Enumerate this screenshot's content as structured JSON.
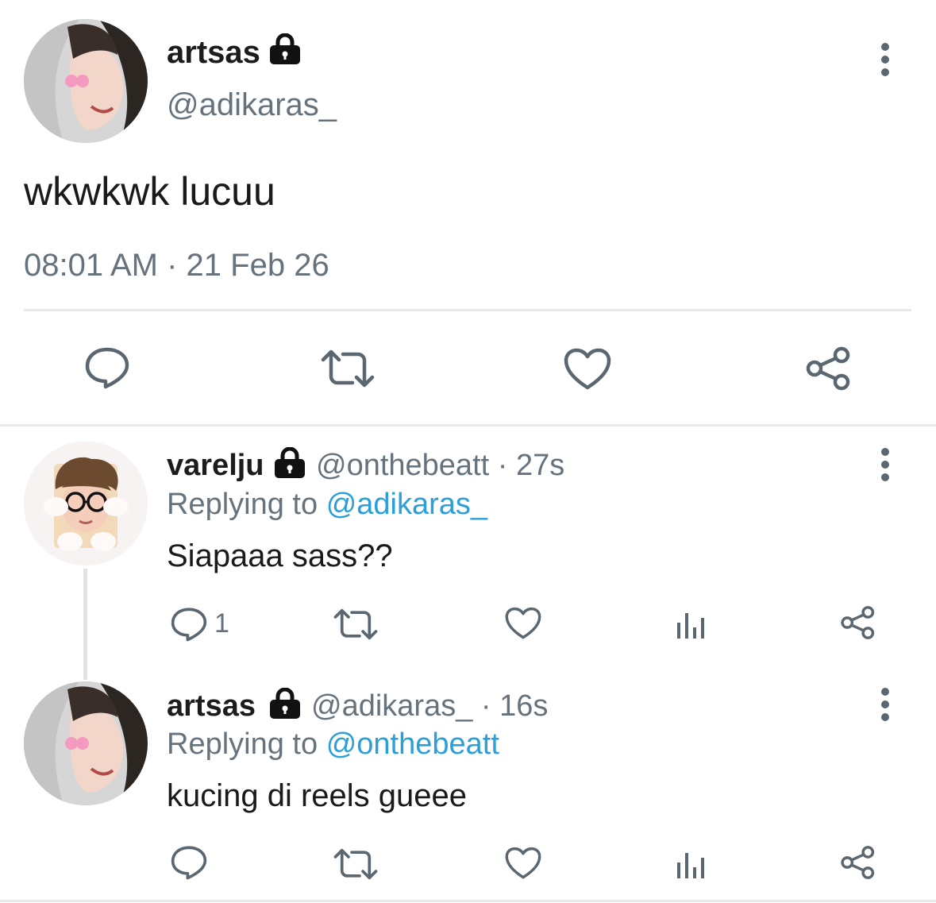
{
  "main_tweet": {
    "name": "artsas",
    "handle": "@adikaras_",
    "text": "wkwkwk lucuu",
    "timestamp": "08:01 AM · 21 Feb 26",
    "avatar_icon": "user-avatar",
    "locked_icon": "lock-icon"
  },
  "replies": [
    {
      "name": "varelju",
      "handle": "@onthebeatt",
      "time": "· 27s",
      "replying_prefix": "Replying to",
      "replying_to": "@adikaras_",
      "text": "Siapaaa sass??",
      "reply_count": "1"
    },
    {
      "name": "artsas",
      "handle": "@adikaras_",
      "time": "· 16s",
      "replying_prefix": "Replying to",
      "replying_to": "@onthebeatt",
      "text": "kucing di reels gueee",
      "reply_count": ""
    }
  ],
  "colors": {
    "accent": "#2a9fd8",
    "icon": "#5b6770",
    "text": "#14171a",
    "divider": "#e6eaed"
  }
}
